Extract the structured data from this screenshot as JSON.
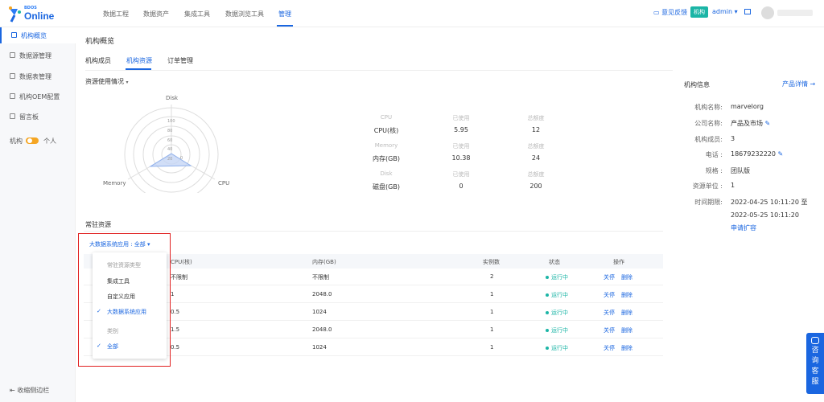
{
  "logo": {
    "small": "BDOS",
    "big": "Online"
  },
  "nav": [
    "数据工程",
    "数据资产",
    "集成工具",
    "数据浏览工具",
    "管理"
  ],
  "topbar": {
    "feedback": "意见反馈",
    "org_badge": "机构",
    "admin": "admin ▾"
  },
  "sidebar": {
    "items": [
      "机构概览",
      "数据源管理",
      "数据表管理",
      "机构OEM配置",
      "留言板"
    ],
    "toggle_left": "机构",
    "toggle_right": "个人",
    "collapse": "收缩侧边栏"
  },
  "page": {
    "title": "机构概览",
    "tabs": [
      "机构成员",
      "机构资源",
      "订单管理"
    ]
  },
  "resource_usage": {
    "label": "资源使用情况",
    "radar": {
      "axes": [
        "Disk",
        "CPU",
        "Memory"
      ],
      "ticks": [
        "0",
        "20",
        "40",
        "60",
        "80",
        "100"
      ]
    },
    "groups": [
      {
        "name": "CPU",
        "used_h": "已使用",
        "total_h": "总额度",
        "row": "CPU(核)",
        "used": "5.95",
        "total": "12"
      },
      {
        "name": "Memory",
        "used_h": "已使用",
        "total_h": "总额度",
        "row": "内存(GB)",
        "used": "10.38",
        "total": "24"
      },
      {
        "name": "Disk",
        "used_h": "已使用",
        "total_h": "总额度",
        "row": "磁盘(GB)",
        "used": "0",
        "total": "200"
      }
    ]
  },
  "org_info": {
    "title": "机构信息",
    "detail_link": "产品详情 →",
    "rows": [
      {
        "label": "机构名称:",
        "value": "marvelorg"
      },
      {
        "label": "公司名称:",
        "value": "产品及市场"
      },
      {
        "label": "机构成员:",
        "value": "3"
      },
      {
        "label": "电话 :",
        "value": "18679232220"
      },
      {
        "label": "规格 :",
        "value": "团队版"
      },
      {
        "label": "资源单位 :",
        "value": "1"
      },
      {
        "label": "时间期限:",
        "value": "2022-04-25 10:11:20 至"
      },
      {
        "label": "",
        "value": "2022-05-25 10:11:20"
      }
    ],
    "apply": "申请扩容"
  },
  "resident": {
    "label": "常驻资源",
    "filter": "大数据系统应用 : 全部 ▾",
    "columns": [
      "CPU(核)",
      "内存(GB)",
      "实例数",
      "状态",
      "操作"
    ],
    "rows": [
      {
        "cpu": "不限制",
        "mem": "不限制",
        "count": "2",
        "status": "运行中",
        "op1": "关停",
        "op2": "删除"
      },
      {
        "cpu": "1",
        "mem": "2048.0",
        "count": "1",
        "status": "运行中",
        "op1": "关停",
        "op2": "删除"
      },
      {
        "cpu": "0.5",
        "mem": "1024",
        "count": "1",
        "status": "运行中",
        "op1": "关停",
        "op2": "删除"
      },
      {
        "cpu": "1.5",
        "mem": "2048.0",
        "count": "1",
        "status": "运行中",
        "op1": "关停",
        "op2": "删除"
      },
      {
        "cpu": "0.5",
        "mem": "1024",
        "count": "1",
        "status": "运行中",
        "op1": "关停",
        "op2": "删除"
      }
    ]
  },
  "dropdown": {
    "group1": "常驻资源类型",
    "items1": [
      "集成工具",
      "自定义应用",
      "大数据系统应用"
    ],
    "group2": "类别",
    "items2": [
      "全部"
    ]
  },
  "kefu": [
    "咨",
    "询",
    "客",
    "服"
  ],
  "colors": {
    "accent": "#1a66e0",
    "running": "#1bb5a6",
    "highlight": "#e02020",
    "toggle": "#f5a623"
  }
}
